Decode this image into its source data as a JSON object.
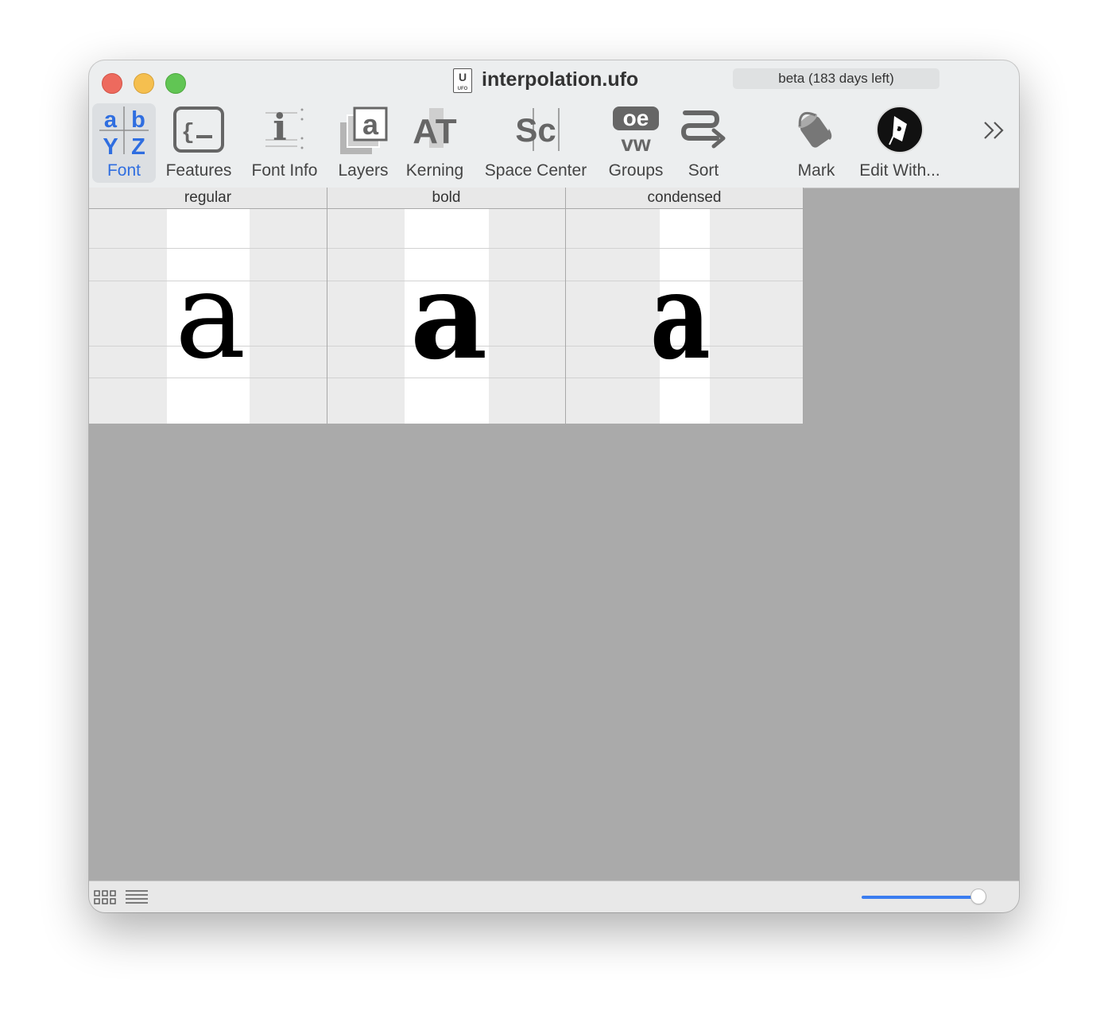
{
  "window": {
    "title": "interpolation.ufo",
    "doc_icon_letter": "U",
    "doc_icon_caption": "UFO",
    "beta_badge": "beta (183 days left)"
  },
  "toolbar": {
    "items": [
      {
        "label": "Font",
        "active": true
      },
      {
        "label": "Features"
      },
      {
        "label": "Font Info"
      },
      {
        "label": "Layers"
      },
      {
        "label": "Kerning"
      },
      {
        "label": "Space Center"
      },
      {
        "label": "Groups"
      },
      {
        "label": "Sort"
      },
      {
        "label": "Mark"
      },
      {
        "label": "Edit With..."
      }
    ],
    "font_icon_letters": [
      "a",
      "b",
      "Y",
      "Z"
    ],
    "fontinfo_icon_letter": "i",
    "layers_icon_letter": "a",
    "kerning_icon_letters": "AT",
    "spacecenter_icon_letters": "Sc",
    "groups_icon_top": "oe",
    "groups_icon_bottom": "vw",
    "accent_color": "#2f6ee0"
  },
  "columns": [
    {
      "name": "regular",
      "glyph": "a"
    },
    {
      "name": "bold",
      "glyph": "a"
    },
    {
      "name": "condensed",
      "glyph": "a"
    }
  ]
}
